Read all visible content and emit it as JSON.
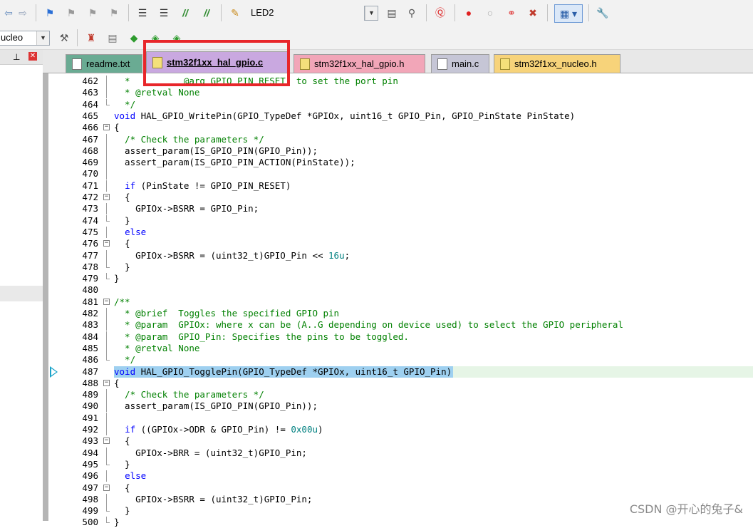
{
  "toolbar1": {
    "target_label": "LED2",
    "icons": [
      "back-arrow-icon",
      "forward-arrow-icon",
      "bookmark-icon",
      "bookmark-prev-icon",
      "bookmark-next-icon",
      "bookmark-clear-icon",
      "indent-icon",
      "unindent-icon",
      "comment-icon",
      "uncomment-icon",
      "target-options-icon",
      "target-combo",
      "file-icon",
      "find-in-files-icon",
      "debug-icon",
      "breakpoint-icon",
      "breakpoint-disable-icon",
      "breakpoint-clear-icon",
      "breakpoint-kill-icon",
      "window-icon",
      "wrench-icon"
    ]
  },
  "toolbar2": {
    "combo_text": "ucleo"
  },
  "panel": {
    "pin_icon": "pin-icon",
    "close_icon": "close-icon"
  },
  "tabs": [
    {
      "label": "readme.txt",
      "color": "#6aab93",
      "active": false
    },
    {
      "label": "stm32f1xx_hal_gpio.c",
      "color": "#c9a8e0",
      "active": true
    },
    {
      "label": "stm32f1xx_hal_gpio.h",
      "color": "#f2a6b8",
      "active": false
    },
    {
      "label": "main.c",
      "color": "#c6c6d6",
      "active": false
    },
    {
      "label": "stm32f1xx_nucleo.h",
      "color": "#f7d37a",
      "active": false
    }
  ],
  "code": {
    "lines": [
      {
        "n": "462",
        "t": "  *          @arg GPIO_PIN_RESET: to set the port pin",
        "cls": "cm",
        "fold": "line"
      },
      {
        "n": "463",
        "t": "  * @retval None",
        "cls": "cm",
        "fold": "line"
      },
      {
        "n": "464",
        "t": "  */",
        "cls": "cm",
        "fold": "end"
      },
      {
        "n": "465",
        "t": "void HAL_GPIO_WritePin(GPIO_TypeDef *GPIOx, uint16_t GPIO_Pin, GPIO_PinState PinState)",
        "cls": "fn",
        "fold": ""
      },
      {
        "n": "466",
        "t": "{",
        "cls": "",
        "fold": "box"
      },
      {
        "n": "467",
        "t": "  /* Check the parameters */",
        "cls": "cm",
        "fold": "line"
      },
      {
        "n": "468",
        "t": "  assert_param(IS_GPIO_PIN(GPIO_Pin));",
        "cls": "",
        "fold": "line"
      },
      {
        "n": "469",
        "t": "  assert_param(IS_GPIO_PIN_ACTION(PinState));",
        "cls": "",
        "fold": "line"
      },
      {
        "n": "470",
        "t": "",
        "cls": "",
        "fold": "line"
      },
      {
        "n": "471",
        "t": "  if (PinState != GPIO_PIN_RESET)",
        "cls": "if",
        "fold": "line"
      },
      {
        "n": "472",
        "t": "  {",
        "cls": "",
        "fold": "box"
      },
      {
        "n": "473",
        "t": "    GPIOx->BSRR = GPIO_Pin;",
        "cls": "",
        "fold": "line"
      },
      {
        "n": "474",
        "t": "  }",
        "cls": "",
        "fold": "end"
      },
      {
        "n": "475",
        "t": "  else",
        "cls": "kwline",
        "fold": "line"
      },
      {
        "n": "476",
        "t": "  {",
        "cls": "",
        "fold": "box"
      },
      {
        "n": "477",
        "t": "    GPIOx->BSRR = (uint32_t)GPIO_Pin << 16u;",
        "cls": "shift",
        "fold": "line"
      },
      {
        "n": "478",
        "t": "  }",
        "cls": "",
        "fold": "end"
      },
      {
        "n": "479",
        "t": "}",
        "cls": "",
        "fold": "end"
      },
      {
        "n": "480",
        "t": "",
        "cls": "",
        "fold": ""
      },
      {
        "n": "481",
        "t": "/**",
        "cls": "cm",
        "fold": "box"
      },
      {
        "n": "482",
        "t": "  * @brief  Toggles the specified GPIO pin",
        "cls": "cm",
        "fold": "line"
      },
      {
        "n": "483",
        "t": "  * @param  GPIOx: where x can be (A..G depending on device used) to select the GPIO peripheral",
        "cls": "cm",
        "fold": "line"
      },
      {
        "n": "484",
        "t": "  * @param  GPIO_Pin: Specifies the pins to be toggled.",
        "cls": "cm",
        "fold": "line"
      },
      {
        "n": "485",
        "t": "  * @retval None",
        "cls": "cm",
        "fold": "line"
      },
      {
        "n": "486",
        "t": "  */",
        "cls": "cm",
        "fold": "end"
      },
      {
        "n": "487",
        "t": "void HAL_GPIO_TogglePin(GPIO_TypeDef *GPIOx, uint16_t GPIO_Pin)",
        "cls": "fn",
        "fold": "",
        "highlight": true
      },
      {
        "n": "488",
        "t": "{",
        "cls": "",
        "fold": "box"
      },
      {
        "n": "489",
        "t": "  /* Check the parameters */",
        "cls": "cm",
        "fold": "line"
      },
      {
        "n": "490",
        "t": "  assert_param(IS_GPIO_PIN(GPIO_Pin));",
        "cls": "",
        "fold": "line"
      },
      {
        "n": "491",
        "t": "",
        "cls": "",
        "fold": "line"
      },
      {
        "n": "492",
        "t": "  if ((GPIOx->ODR & GPIO_Pin) != 0x00u)",
        "cls": "ifnum",
        "fold": "line"
      },
      {
        "n": "493",
        "t": "  {",
        "cls": "",
        "fold": "box"
      },
      {
        "n": "494",
        "t": "    GPIOx->BRR = (uint32_t)GPIO_Pin;",
        "cls": "",
        "fold": "line"
      },
      {
        "n": "495",
        "t": "  }",
        "cls": "",
        "fold": "end"
      },
      {
        "n": "496",
        "t": "  else",
        "cls": "kwline",
        "fold": "line"
      },
      {
        "n": "497",
        "t": "  {",
        "cls": "",
        "fold": "box"
      },
      {
        "n": "498",
        "t": "    GPIOx->BSRR = (uint32_t)GPIO_Pin;",
        "cls": "",
        "fold": "line"
      },
      {
        "n": "499",
        "t": "  }",
        "cls": "",
        "fold": "end"
      },
      {
        "n": "500",
        "t": "}",
        "cls": "",
        "fold": "end"
      }
    ]
  },
  "watermark": "CSDN @开心的兔子&",
  "colors": {
    "highlight_row": "#e6f5e6",
    "highlight_text": "#9ed0f0",
    "annotation_box": "#e8262a",
    "keyword": "#0000ff",
    "comment": "#008000",
    "number": "#008080"
  }
}
